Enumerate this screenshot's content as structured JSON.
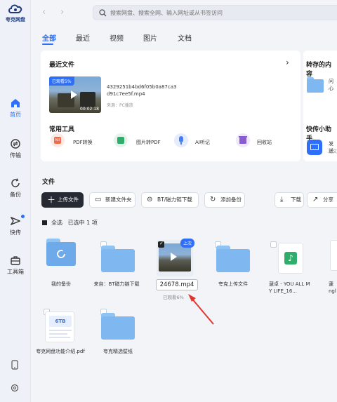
{
  "app": {
    "logo_text": "夸克网盘"
  },
  "search": {
    "placeholder": "搜索网盘、搜索全网、输入网址或从书签访问"
  },
  "sidebar": {
    "items": [
      {
        "label": "首页",
        "icon": "home-icon",
        "active": true
      },
      {
        "label": "传输",
        "icon": "transfer-icon"
      },
      {
        "label": "备份",
        "icon": "backup-icon"
      },
      {
        "label": "快传",
        "icon": "quick-transfer-icon"
      },
      {
        "label": "工具箱",
        "icon": "toolbox-icon"
      }
    ]
  },
  "tabs": [
    "全部",
    "最近",
    "视频",
    "图片",
    "文档"
  ],
  "recent": {
    "title": "最近文件",
    "arrow": "›",
    "badge": "已观看5%",
    "duration": "00:02:18",
    "filename": "4329251b4bd6f05b0a87ca3d91c7ee5f.mp4",
    "source": "来源：PC播放"
  },
  "saved": {
    "title": "转存的内容",
    "text": "问心"
  },
  "tools": {
    "title": "常用工具",
    "items": [
      {
        "label": "PDF转换",
        "color": "#f26b4b",
        "icon": "pdf-icon",
        "icon_text": "PDF"
      },
      {
        "label": "图片转PDF",
        "color": "#2eae6a",
        "icon": "image-to-pdf-icon"
      },
      {
        "label": "AI听记",
        "color": "#4a7ff2",
        "icon": "microphone-icon"
      },
      {
        "label": "回收站",
        "color": "#8a5cd1",
        "icon": "recycle-bin-icon"
      }
    ]
  },
  "helper": {
    "title": "快传小助手",
    "text": "发送",
    "subtext": "把文"
  },
  "files": {
    "title": "文件",
    "buttons": {
      "upload": "上传文件",
      "new_folder": "新建文件夹",
      "bt": "BT/磁力链下载",
      "add_backup": "添加备份",
      "download": "下载",
      "share": "分享"
    },
    "select_all": "全选",
    "selected": "已选中 1 项",
    "items": [
      {
        "name": "我的备份",
        "type": "backup-folder"
      },
      {
        "name": "来自：BT磁力链下载",
        "type": "folder"
      },
      {
        "name": "24678.mp4",
        "type": "video",
        "watched": "已观看6%",
        "tag": "上次",
        "rename": true
      },
      {
        "name": "夸克上传文件",
        "type": "folder"
      },
      {
        "name": "蘧卓 - YOU ALL MY LIFE_16...",
        "type": "audio"
      },
      {
        "name": "蘧\nngl",
        "type": "partial"
      },
      {
        "name": "夸克网盘功能介绍.pdf",
        "type": "pdf",
        "thumb_text": "6TB"
      },
      {
        "name": "夸克精选壁纸",
        "type": "folder"
      }
    ]
  }
}
